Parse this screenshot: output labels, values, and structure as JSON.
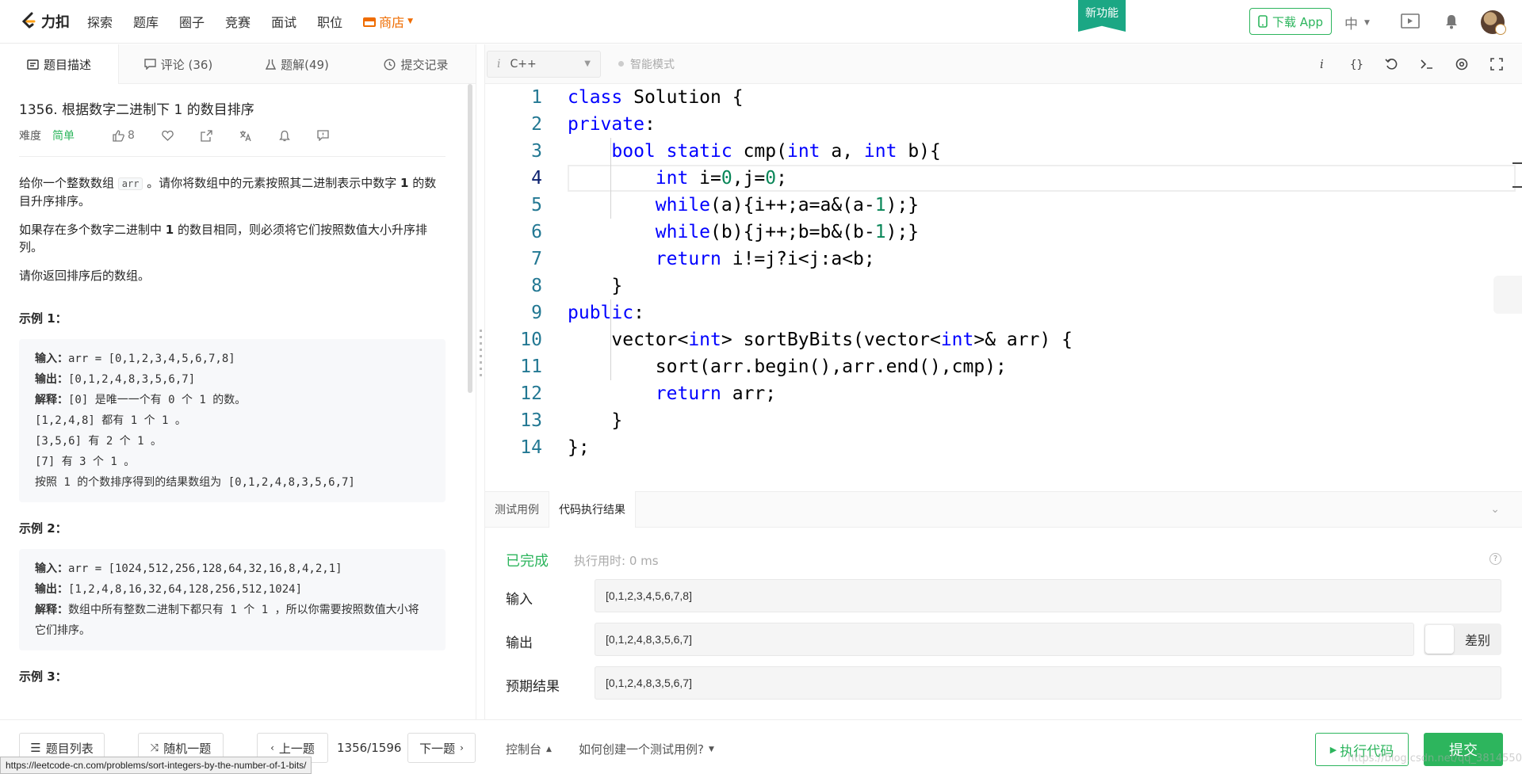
{
  "navbar": {
    "logo_text": "力扣",
    "items": [
      "探索",
      "题库",
      "圈子",
      "竞赛",
      "面试",
      "职位"
    ],
    "shop": "商店",
    "new_feature": "新功能",
    "download_app": "下载 App",
    "language": "中"
  },
  "left_tabs": [
    {
      "label": "题目描述",
      "icon": "document-icon"
    },
    {
      "label": "评论 (36)",
      "icon": "comment-icon"
    },
    {
      "label": "题解(49)",
      "icon": "flask-icon"
    },
    {
      "label": "提交记录",
      "icon": "clock-icon"
    }
  ],
  "problem": {
    "title": "1356. 根据数字二进制下 1 的数目排序",
    "difficulty_label": "难度",
    "difficulty": "简单",
    "likes": "8",
    "desc": {
      "p1_a": "给你一个整数数组 ",
      "p1_code": "arr",
      "p1_b": " 。请你将数组中的元素按照其二进制表示中数字 ",
      "p1_bold": "1",
      "p1_c": " 的数目升序排序。",
      "p2_a": "如果存在多个数字二进制中 ",
      "p2_bold": "1",
      "p2_b": " 的数目相同，则必须将它们按照数值大小升序排列。",
      "p3": "请你返回排序后的数组。"
    },
    "example1": {
      "heading": "示例 1：",
      "input_label": "输入：",
      "input": "arr = [0,1,2,3,4,5,6,7,8]",
      "output_label": "输出：",
      "output": "[0,1,2,4,8,3,5,6,7]",
      "explain_label": "解释：",
      "explain_lines": [
        "[0] 是唯一一个有 0 个 1 的数。",
        "[1,2,4,8] 都有 1 个 1 。",
        "[3,5,6] 有 2 个 1 。",
        "[7] 有 3 个 1 。",
        "按照 1 的个数排序得到的结果数组为 [0,1,2,4,8,3,5,6,7]"
      ]
    },
    "example2": {
      "heading": "示例 2：",
      "input_label": "输入：",
      "input": "arr = [1024,512,256,128,64,32,16,8,4,2,1]",
      "output_label": "输出：",
      "output": "[1,2,4,8,16,32,64,128,256,512,1024]",
      "explain_label": "解释：",
      "explain": "数组中所有整数二进制下都只有 1 个 1 ，所以你需要按照数值大小将它们排序。"
    },
    "example3": {
      "heading": "示例 3："
    }
  },
  "editor": {
    "language": "C++",
    "smart_mode": "智能模式",
    "toolbar_icons": [
      "info-icon",
      "braces-icon",
      "reset-icon",
      "terminal-icon",
      "settings-icon",
      "fullscreen-icon"
    ],
    "code_lines": [
      [
        {
          "t": "class",
          "c": "kw"
        },
        {
          "t": " Solution {"
        }
      ],
      [
        {
          "t": "private",
          "c": "kw"
        },
        {
          "t": ":"
        }
      ],
      [
        {
          "t": "    "
        },
        {
          "t": "bool",
          "c": "kw"
        },
        {
          "t": " "
        },
        {
          "t": "static",
          "c": "kw"
        },
        {
          "t": " cmp("
        },
        {
          "t": "int",
          "c": "kw"
        },
        {
          "t": " a, "
        },
        {
          "t": "int",
          "c": "kw"
        },
        {
          "t": " b){"
        }
      ],
      [
        {
          "t": "        "
        },
        {
          "t": "int",
          "c": "kw"
        },
        {
          "t": " i="
        },
        {
          "t": "0",
          "c": "num"
        },
        {
          "t": ",j="
        },
        {
          "t": "0",
          "c": "num"
        },
        {
          "t": ";"
        }
      ],
      [
        {
          "t": "        "
        },
        {
          "t": "while",
          "c": "kw"
        },
        {
          "t": "(a){i++;a=a&(a-"
        },
        {
          "t": "1",
          "c": "num"
        },
        {
          "t": ");}"
        }
      ],
      [
        {
          "t": "        "
        },
        {
          "t": "while",
          "c": "kw"
        },
        {
          "t": "(b){j++;b=b&(b-"
        },
        {
          "t": "1",
          "c": "num"
        },
        {
          "t": ");}"
        }
      ],
      [
        {
          "t": "        "
        },
        {
          "t": "return",
          "c": "kw"
        },
        {
          "t": " i!=j?i<j:a<b;"
        }
      ],
      [
        {
          "t": "    }"
        }
      ],
      [
        {
          "t": "public",
          "c": "kw"
        },
        {
          "t": ":"
        }
      ],
      [
        {
          "t": "    vector<"
        },
        {
          "t": "int",
          "c": "kw"
        },
        {
          "t": "> sortByBits(vector<"
        },
        {
          "t": "int",
          "c": "kw"
        },
        {
          "t": ">& arr) {"
        }
      ],
      [
        {
          "t": "        sort(arr.begin(),arr.end(),cmp);"
        }
      ],
      [
        {
          "t": "        "
        },
        {
          "t": "return",
          "c": "kw"
        },
        {
          "t": " arr;"
        }
      ],
      [
        {
          "t": "    }"
        }
      ],
      [
        {
          "t": "};"
        }
      ]
    ],
    "active_line": 4
  },
  "console": {
    "tabs": [
      "测试用例",
      "代码执行结果"
    ],
    "status": "已完成",
    "time": "执行用时: 0 ms",
    "help": "?",
    "input_label": "输入",
    "input_value": "[0,1,2,3,4,5,6,7,8]",
    "output_label": "输出",
    "output_value": "[0,1,2,4,8,3,5,6,7]",
    "diff_label": "差别",
    "expected_label": "预期结果",
    "expected_value": "[0,1,2,4,8,3,5,6,7]"
  },
  "footer": {
    "problem_list": "题目列表",
    "random": "随机一题",
    "prev": "上一题",
    "page": "1356/1596",
    "next": "下一题",
    "console": "控制台",
    "how_to": "如何创建一个测试用例?",
    "run": "执行代码",
    "submit": "提交"
  },
  "status_url": "https://leetcode-cn.com/problems/sort-integers-by-the-number-of-1-bits/",
  "watermark": "https://blog.csdn.net/qq_38145502",
  "colors": {
    "accent": "#2db55d",
    "shop": "#ef6c00",
    "keyword": "#0000ff",
    "number": "#098658",
    "new_feature": "#1ba784"
  }
}
